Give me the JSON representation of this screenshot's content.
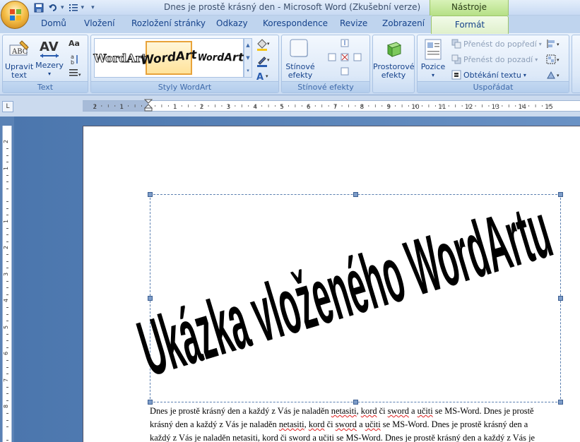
{
  "window": {
    "title": "Dnes je prostě krásný den - Microsoft Word (Zkušební verze)",
    "contextual_tab_header": "Nástroje WordArtu"
  },
  "tabs": [
    "Domů",
    "Vložení",
    "Rozložení stránky",
    "Odkazy",
    "Korespondence",
    "Revize",
    "Zobrazení",
    "Formát"
  ],
  "ribbon": {
    "text_group": {
      "label": "Text",
      "upravit_text": [
        "Upravit",
        "text"
      ],
      "mezery": "Mezery",
      "aa_label": "Aa"
    },
    "styles_group": {
      "label": "Styly WordArt",
      "gallery": [
        "WordArt",
        "WordArt",
        "WordArt"
      ]
    },
    "shadow_group": {
      "label": "Stínové efekty",
      "button": [
        "Stínové",
        "efekty"
      ]
    },
    "three_d_group": {
      "button": [
        "Prostorové",
        "efekty"
      ]
    },
    "arrange_group": {
      "label": "Uspořádat",
      "pozice": "Pozice",
      "prenest_popredi": "Přenést do popředí",
      "prenest_pozadi": "Přenést do pozadí",
      "obtekani": "Obtékání textu"
    }
  },
  "ruler": {
    "corner": "L",
    "h_labels": [
      "2",
      "1",
      "1",
      "2",
      "3",
      "4",
      "5",
      "6",
      "7",
      "8",
      "9",
      "10",
      "11",
      "12",
      "13",
      "14",
      "15"
    ],
    "v_labels": [
      "2",
      "1",
      "1",
      "2",
      "3",
      "4",
      "5",
      "6",
      "7",
      "8"
    ]
  },
  "document": {
    "wordart_text": "Ukázka vloženého WordArtu",
    "body_lines": [
      [
        "Dnes je prostě krásný den a každý z Vás je naladěn ",
        "netasiti",
        ", ",
        "kord",
        " či ",
        "sword",
        " a ",
        "učiti",
        " se MS-Word. Dnes je prostě"
      ],
      [
        "krásný den a každý z Vás je naladěn ",
        "netasiti",
        ", ",
        "kord",
        " či ",
        "sword",
        " a ",
        "učiti",
        " se MS-Word. Dnes je prostě krásný den a"
      ],
      [
        "každý z Vás je naladěn ",
        "netasiti",
        ", ",
        "kord",
        " či ",
        "sword",
        " a ",
        "učiti",
        " se MS-Word. Dnes je prostě krásný den a každý z Vás je"
      ]
    ]
  },
  "colors": {
    "ribbon_text": "#15428b",
    "context_tab": "#b6e086",
    "selection": "#e8a33a"
  }
}
